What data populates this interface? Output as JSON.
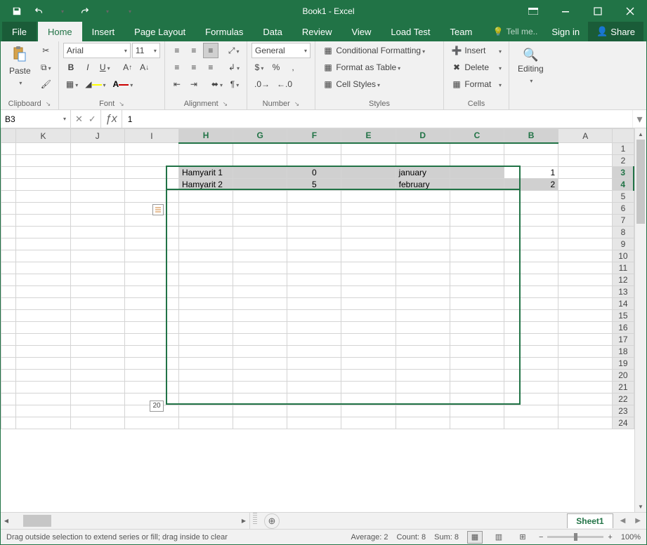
{
  "title": "Book1 - Excel",
  "tabs": {
    "file": "File",
    "home": "Home",
    "insert": "Insert",
    "page_layout": "Page Layout",
    "formulas": "Formulas",
    "data": "Data",
    "review": "Review",
    "view": "View",
    "load_test": "Load Test",
    "team": "Team"
  },
  "tell_me": "Tell me..",
  "sign_in": "Sign in",
  "share": "Share",
  "ribbon": {
    "clipboard": {
      "paste": "Paste",
      "label": "Clipboard"
    },
    "font": {
      "name": "Arial",
      "size": "11",
      "label": "Font"
    },
    "alignment": {
      "label": "Alignment"
    },
    "number": {
      "format": "General",
      "label": "Number"
    },
    "styles": {
      "cond": "Conditional Formatting",
      "table": "Format as Table",
      "cell": "Cell Styles",
      "label": "Styles"
    },
    "cells": {
      "insert": "Insert",
      "delete": "Delete",
      "format": "Format",
      "label": "Cells"
    },
    "editing": {
      "label": "Editing"
    }
  },
  "name_box": "B3",
  "formula": "1",
  "columns": [
    "K",
    "J",
    "I",
    "H",
    "G",
    "F",
    "E",
    "D",
    "C",
    "B",
    "A"
  ],
  "col_sel": [
    "H",
    "G",
    "F",
    "E",
    "D",
    "C",
    "B"
  ],
  "rows_count": 24,
  "row_sel": [
    3,
    4
  ],
  "cells": {
    "H3": "Hamyarit 1",
    "F3": "0",
    "D3": "january",
    "B3": "1",
    "H4": "Hamyarit 2",
    "F4": "5",
    "D4": "february",
    "B4": "2"
  },
  "fill_hint": "20",
  "sheet_tab": "Sheet1",
  "status": {
    "mode": "Drag outside selection to extend series or fill; drag inside to clear",
    "average": "Average: 2",
    "count": "Count: 8",
    "sum": "Sum: 8",
    "zoom": "100%"
  }
}
